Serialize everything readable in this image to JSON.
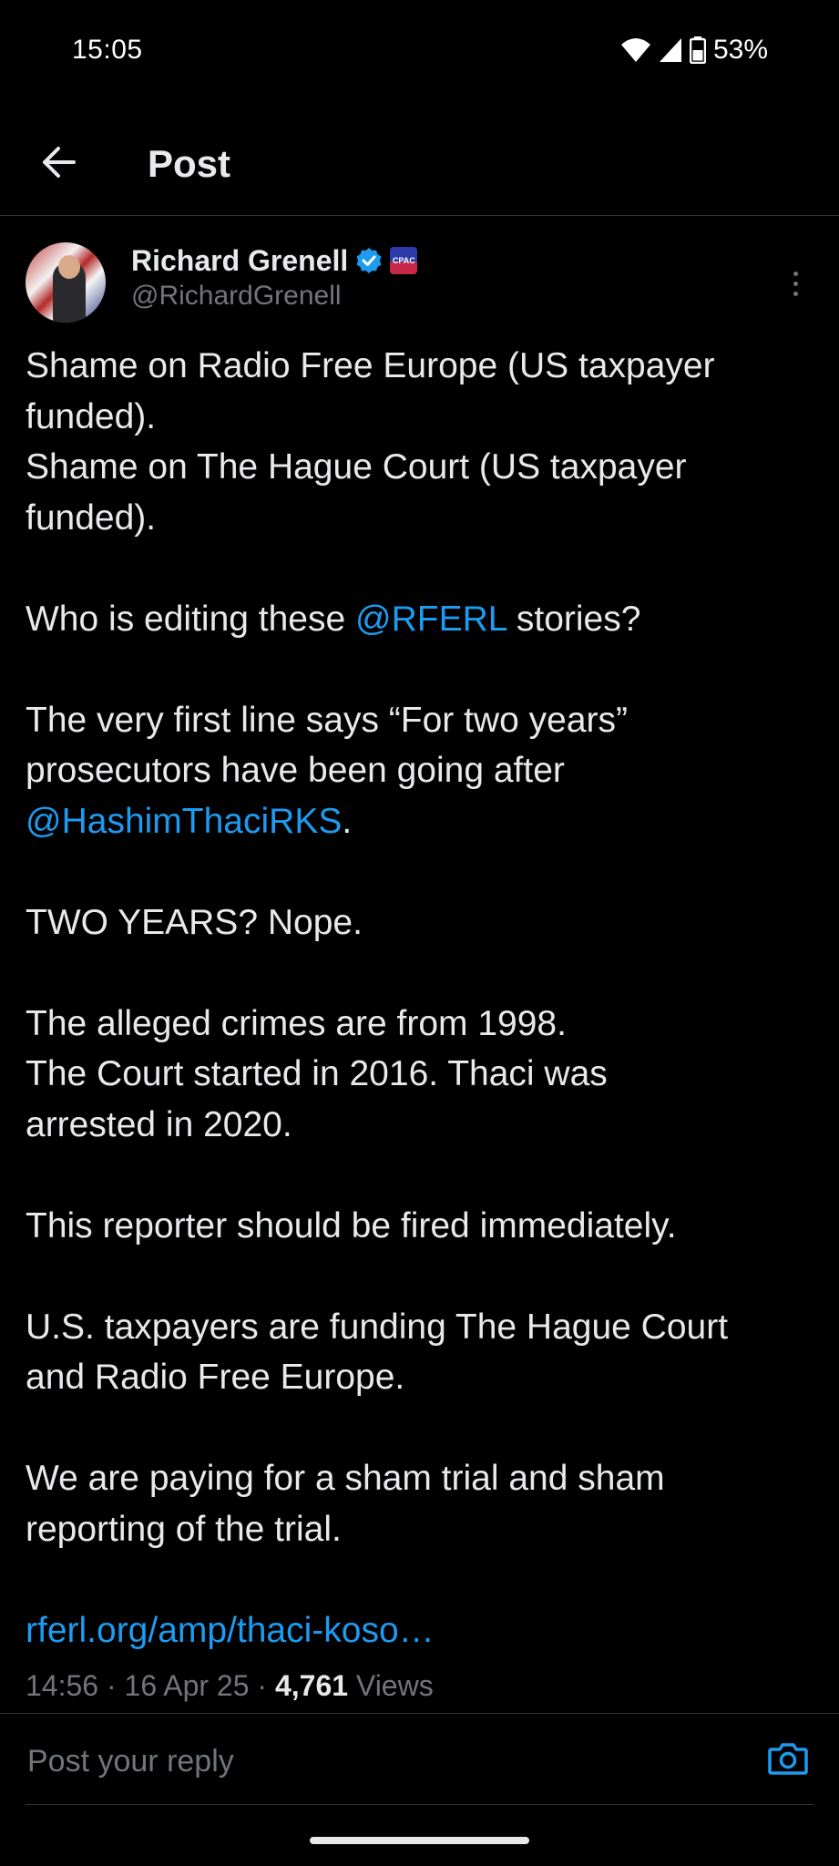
{
  "status_bar": {
    "time": "15:05",
    "battery_percent": "53%",
    "icons": [
      "wifi-icon",
      "cellular-signal-icon",
      "battery-icon"
    ]
  },
  "header": {
    "title": "Post",
    "back_icon": "arrow-left-icon"
  },
  "author": {
    "name": "Richard Grenell",
    "handle": "@RichardGrenell",
    "verified": true,
    "affiliate_badge_text": "CPAC"
  },
  "post": {
    "paragraphs": [
      {
        "lines": [
          "Shame on Radio Free Europe (US taxpayer",
          "funded).",
          "Shame on The Hague Court (US taxpayer",
          "funded)."
        ]
      },
      {
        "before": "Who is editing these ",
        "mention": "@RFERL",
        "after": " stories?"
      },
      {
        "lines": [
          "The very first line says “For two years”",
          "prosecutors have been going after"
        ],
        "mention": "@HashimThaciRKS",
        "after": "."
      },
      {
        "text": "TWO YEARS? Nope."
      },
      {
        "lines": [
          "The alleged crimes are from 1998.",
          "The Court started in 2016. Thaci was",
          "arrested in 2020."
        ]
      },
      {
        "text": "This reporter should be fired immediately."
      },
      {
        "lines": [
          "U.S. taxpayers are funding The Hague Court",
          "and Radio Free Europe."
        ]
      },
      {
        "lines": [
          "We are paying for a sham trial and sham",
          "reporting of the trial."
        ]
      }
    ],
    "link": "rferl.org/amp/thaci-koso…"
  },
  "meta": {
    "time": "14:56",
    "separator": " · ",
    "date": "16 Apr 25",
    "views_count": "4,761",
    "views_label": " Views"
  },
  "reply": {
    "placeholder": "Post your reply"
  },
  "colors": {
    "background": "#000000",
    "text": "#e7e9ea",
    "muted": "#71767b",
    "accent": "#1d9bf0",
    "divider": "#2f3336"
  }
}
